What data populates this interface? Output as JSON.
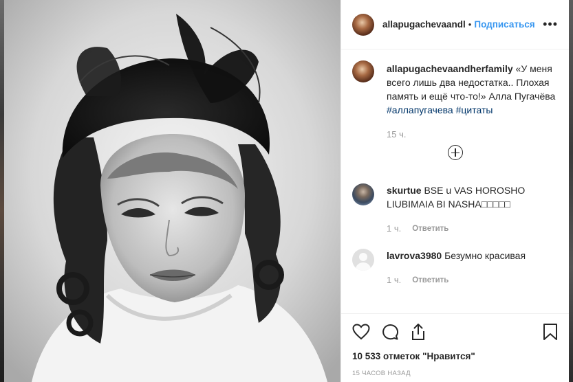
{
  "post": {
    "author": "allapugachevaandl",
    "separator": "•",
    "follow_label": "Подписаться",
    "more_label": "•••"
  },
  "caption": {
    "user": "allapugachevaandherfamily",
    "text": " «У меня всего лишь два недостатка.. Плохая память и ещё что-то!» Алла Пугачёва ",
    "hashtag1": "#аллапугачева",
    "hashtag2": "#цитаты",
    "time": "15 ч."
  },
  "comments": [
    {
      "user": "skurtue",
      "text": " BSE u VAS HOROSHO LIUBIMAIA BI NASHA□□□□□",
      "time": "1 ч.",
      "reply": "Ответить"
    },
    {
      "user": "lavrova3980",
      "text": " Безумно красивая",
      "time": "1 ч.",
      "reply": "Ответить"
    }
  ],
  "footer": {
    "likes": "10 533 отметок \"Нравится\"",
    "timestamp": "15 ЧАСОВ НАЗАД"
  },
  "icons": [
    "heart-icon",
    "comment-icon",
    "share-icon",
    "bookmark-icon",
    "plus-circle-icon",
    "more-icon"
  ],
  "colors": {
    "link": "#3897f0",
    "hashtag": "#003569",
    "text": "#262626",
    "muted": "#999999"
  }
}
